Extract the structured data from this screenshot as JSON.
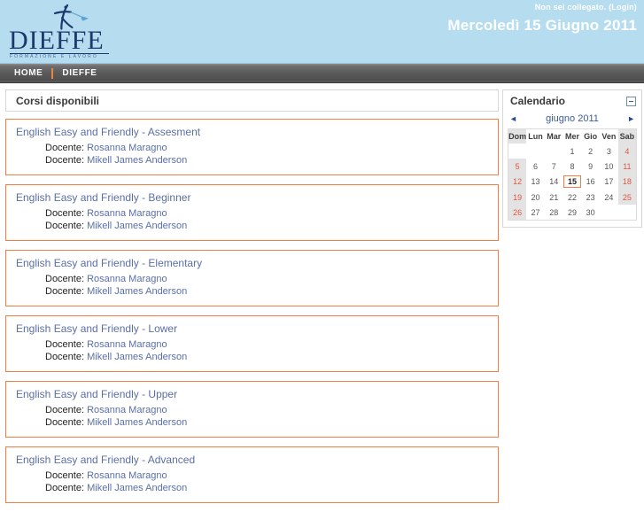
{
  "header": {
    "logo_word": "DIEFFE",
    "logo_tagline": "FORMAZIONE E LAVORO",
    "login_text": "Non sei collegato. (Login)",
    "date_text": "Mercoledì 15 Giugno 2011",
    "brand_blue": "#b6dcf0",
    "logo_navy": "#1b3a6b"
  },
  "nav": {
    "items": [
      {
        "label": "HOME"
      },
      {
        "label": "DIEFFE"
      }
    ],
    "separator_color": "#e8863c"
  },
  "main": {
    "section_title": "Corsi disponibili",
    "teacher_label": "Docente:",
    "accent_color": "#ef7f43",
    "link_color": "#5a6fa8",
    "courses": [
      {
        "title": "English Easy and Friendly - Assesment",
        "teachers": [
          "Rosanna Maragno",
          "Mikell James Anderson"
        ]
      },
      {
        "title": "English Easy and Friendly - Beginner",
        "teachers": [
          "Rosanna Maragno",
          "Mikell James Anderson"
        ]
      },
      {
        "title": "English Easy and Friendly - Elementary",
        "teachers": [
          "Rosanna Maragno",
          "Mikell James Anderson"
        ]
      },
      {
        "title": "English Easy and Friendly - Lower",
        "teachers": [
          "Rosanna Maragno",
          "Mikell James Anderson"
        ]
      },
      {
        "title": "English Easy and Friendly - Upper",
        "teachers": [
          "Rosanna Maragno",
          "Mikell James Anderson"
        ]
      },
      {
        "title": "English Easy and Friendly - Advanced",
        "teachers": [
          "Rosanna Maragno",
          "Mikell James Anderson"
        ]
      }
    ]
  },
  "calendar": {
    "title": "Calendario",
    "collapse_icon": "minimize-icon",
    "prev_icon": "◄",
    "next_icon": "►",
    "month_label": "giugno 2011",
    "weekdays": [
      "Dom",
      "Lun",
      "Mar",
      "Mer",
      "Gio",
      "Ven",
      "Sab"
    ],
    "weekend_columns": [
      0,
      6
    ],
    "today": 15,
    "weeks": [
      [
        "",
        "",
        "",
        "1",
        "2",
        "3",
        "4"
      ],
      [
        "5",
        "6",
        "7",
        "8",
        "9",
        "10",
        "11"
      ],
      [
        "12",
        "13",
        "14",
        "15",
        "16",
        "17",
        "18"
      ],
      [
        "19",
        "20",
        "21",
        "22",
        "23",
        "24",
        "25"
      ],
      [
        "26",
        "27",
        "28",
        "29",
        "30",
        "",
        ""
      ]
    ],
    "weekend_text_color": "#e2553f",
    "weekend_bg_color": "#e3e3e3",
    "today_border_color": "#ef7f43"
  }
}
